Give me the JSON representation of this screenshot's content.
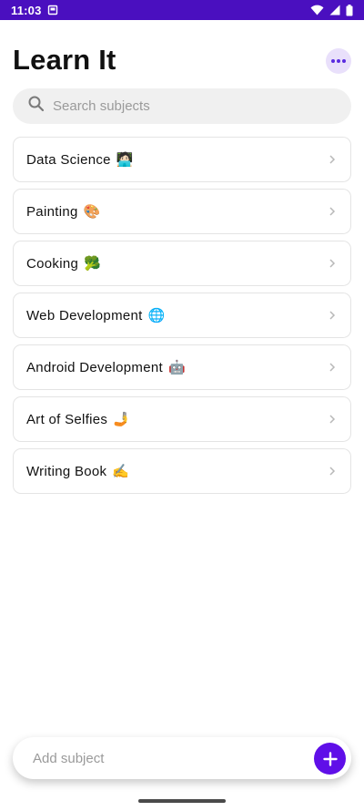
{
  "status_bar": {
    "time": "11:03",
    "background": "#4a0fbf"
  },
  "header": {
    "title": "Learn It",
    "more_icon": "more-horizontal-icon"
  },
  "search": {
    "placeholder": "Search subjects",
    "icon": "search-icon"
  },
  "subjects": [
    {
      "label": "Data Science",
      "emoji": "🧑🏻‍💻"
    },
    {
      "label": "Painting",
      "emoji": "🎨"
    },
    {
      "label": "Cooking",
      "emoji": "🥦"
    },
    {
      "label": "Web Development",
      "emoji": "🌐"
    },
    {
      "label": "Android Development",
      "emoji": "🤖"
    },
    {
      "label": "Art of Selfies",
      "emoji": "🤳"
    },
    {
      "label": "Writing Book",
      "emoji": "✍️"
    }
  ],
  "add_bar": {
    "placeholder": "Add subject",
    "button_icon": "plus-icon"
  },
  "colors": {
    "accent": "#5f0fe8",
    "accent_light": "#e9e0fb"
  }
}
